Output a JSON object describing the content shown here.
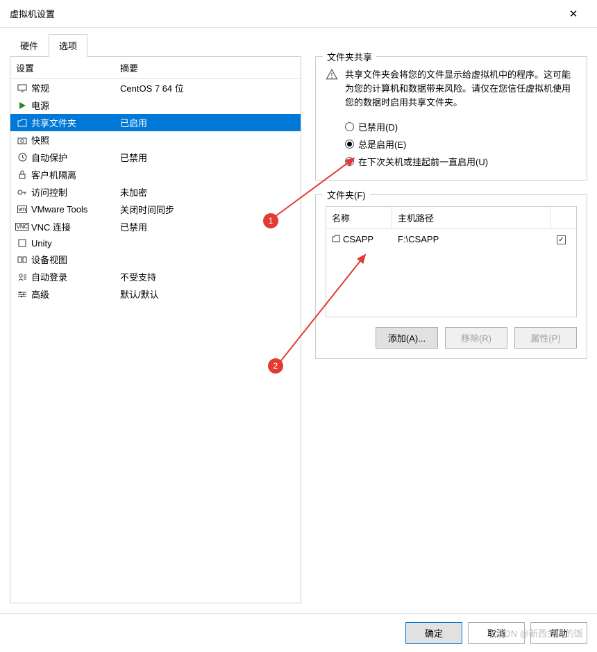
{
  "window": {
    "title": "虚拟机设置"
  },
  "tabs": {
    "hardware": "硬件",
    "options": "选项",
    "active": "options"
  },
  "leftList": {
    "headers": {
      "setting": "设置",
      "summary": "摘要"
    },
    "items": [
      {
        "icon": "monitor",
        "label": "常规",
        "summary": "CentOS 7 64 位"
      },
      {
        "icon": "play",
        "label": "电源",
        "summary": ""
      },
      {
        "icon": "folder",
        "label": "共享文件夹",
        "summary": "已启用",
        "selected": true
      },
      {
        "icon": "camera",
        "label": "快照",
        "summary": ""
      },
      {
        "icon": "clock",
        "label": "自动保护",
        "summary": "已禁用"
      },
      {
        "icon": "lock",
        "label": "客户机隔离",
        "summary": ""
      },
      {
        "icon": "key",
        "label": "访问控制",
        "summary": "未加密"
      },
      {
        "icon": "vm",
        "label": "VMware Tools",
        "summary": "关闭时间同步"
      },
      {
        "icon": "vnc",
        "label": "VNC 连接",
        "summary": "已禁用"
      },
      {
        "icon": "unity",
        "label": "Unity",
        "summary": ""
      },
      {
        "icon": "device",
        "label": "设备视图",
        "summary": ""
      },
      {
        "icon": "login",
        "label": "自动登录",
        "summary": "不受支持"
      },
      {
        "icon": "adv",
        "label": "高级",
        "summary": "默认/默认"
      }
    ]
  },
  "sharingGroup": {
    "title": "文件夹共享",
    "warning": "共享文件夹会将您的文件显示给虚拟机中的程序。这可能为您的计算机和数据带来风险。请仅在您信任虚拟机使用您的数据时启用共享文件夹。",
    "radios": {
      "disabled": "已禁用(D)",
      "always": "总是启用(E)",
      "untilNext": "在下次关机或挂起前一直启用(U)",
      "selected": "always"
    }
  },
  "folderGroup": {
    "title": "文件夹(F)",
    "headers": {
      "name": "名称",
      "hostPath": "主机路径"
    },
    "rows": [
      {
        "name": "CSAPP",
        "path": "F:\\CSAPP",
        "checked": true
      }
    ],
    "buttons": {
      "add": "添加(A)...",
      "remove": "移除(R)",
      "props": "属性(P)"
    }
  },
  "footer": {
    "ok": "确定",
    "cancel": "取消",
    "help": "帮助"
  },
  "annotations": {
    "b1": "1",
    "b2": "2"
  },
  "watermark": "CSDN @新西兰做的饭"
}
